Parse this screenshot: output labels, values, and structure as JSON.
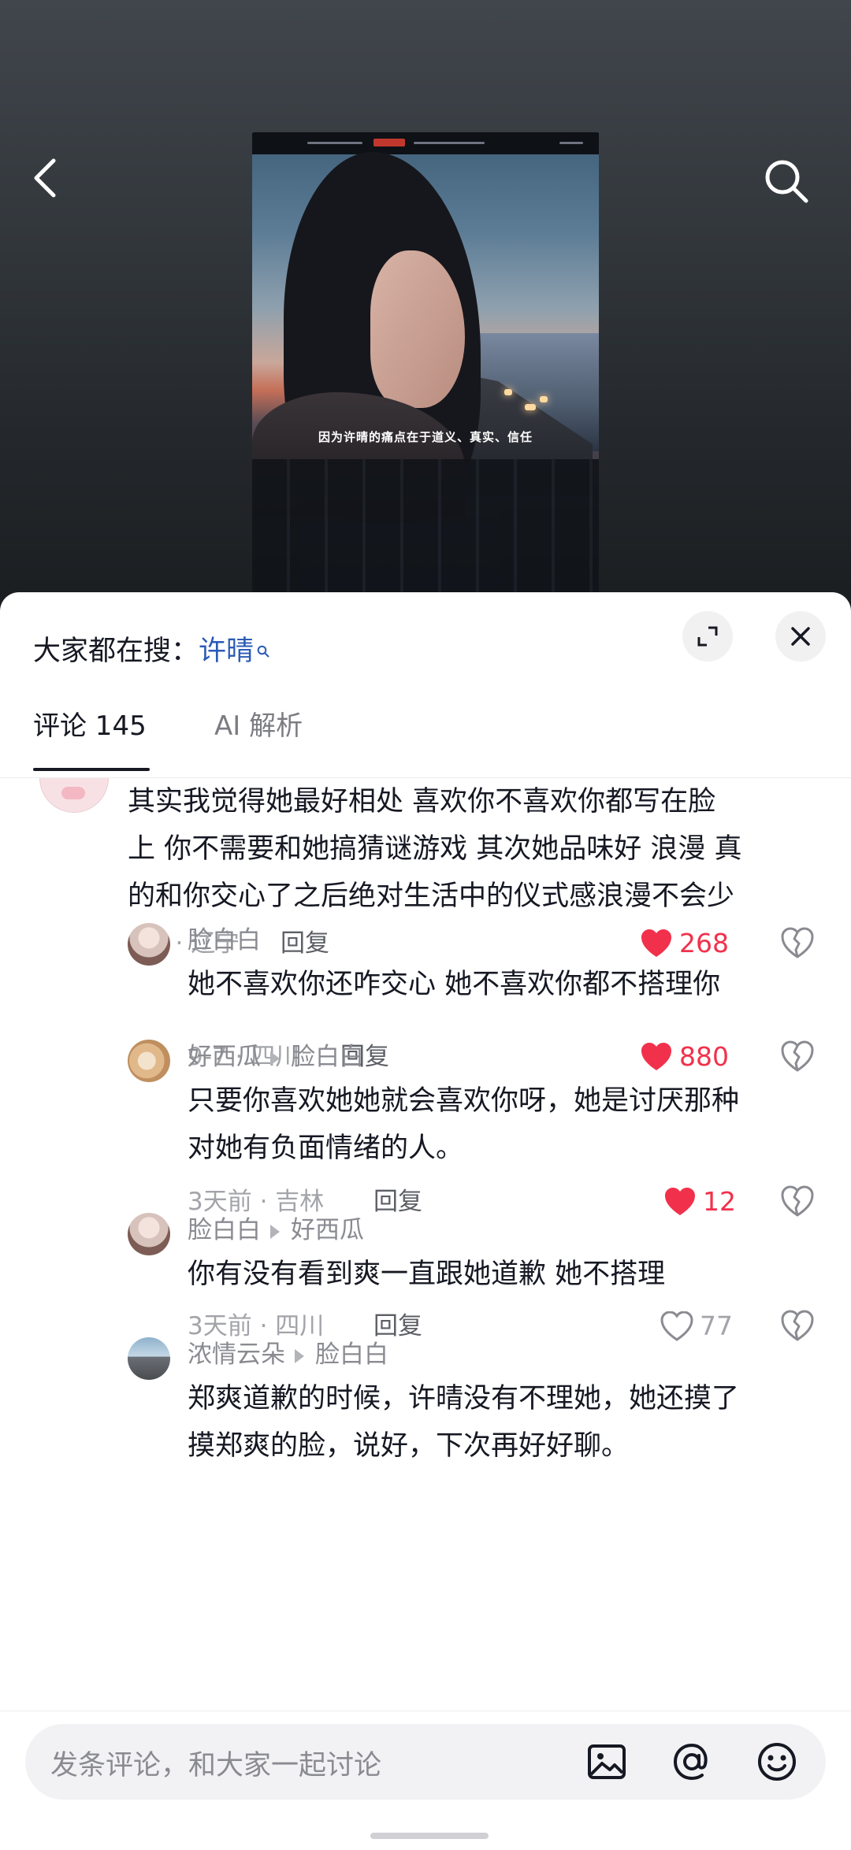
{
  "video": {
    "subtitle": "因为许晴的痛点在于道义、真实、信任"
  },
  "icons": {
    "back": "chevron-left-icon",
    "search": "search-icon",
    "expand": "expand-icon",
    "close": "close-icon",
    "heart": "heart-icon",
    "dislike": "broken-heart-icon",
    "image": "image-icon",
    "at": "at-icon",
    "emoji": "emoji-icon"
  },
  "colors": {
    "liked": "#f1314c",
    "keyword": "#2a5bb6",
    "text": "#161823",
    "meta": "#a3a4a9"
  },
  "hot_search": {
    "prefix": "大家都在搜：",
    "keyword": "许晴"
  },
  "tabs": {
    "comments": "评论 145",
    "ai": "AI 解析"
  },
  "comments": [
    {
      "text_lines": [
        "其实我觉得她最好相处 喜欢你不喜欢你都写在脸",
        "上 你不需要和她搞猜谜游戏 其次她品味好 浪漫 真",
        "的和你交心了之后绝对生活中的仪式感浪漫不会少"
      ],
      "meta": "9-7 · 辽宁",
      "reply": "回复",
      "likes": "268",
      "liked": true
    },
    {
      "user": "脸白白",
      "text_lines": [
        "她不喜欢你还咋交心 她不喜欢你都不搭理你"
      ],
      "meta": "9-7 · 四川",
      "reply": "回复",
      "likes": "880",
      "liked": true
    },
    {
      "user": "好西瓜",
      "reply_to": "脸白白",
      "text_lines": [
        "只要你喜欢她她就会喜欢你呀，她是讨厌那种",
        "对她有负面情绪的人。"
      ],
      "meta": "3天前 · 吉林",
      "reply": "回复",
      "likes": "12",
      "liked": true
    },
    {
      "user": "脸白白",
      "reply_to": "好西瓜",
      "text_lines": [
        "你有没有看到爽一直跟她道歉 她不搭理"
      ],
      "meta": "3天前 · 四川",
      "reply": "回复",
      "likes": "77",
      "liked": false
    },
    {
      "user": "浓情云朵",
      "reply_to": "脸白白",
      "text_lines": [
        "郑爽道歉的时候，许晴没有不理她，她还摸了",
        "摸郑爽的脸，说好，下次再好好聊。"
      ]
    }
  ],
  "input": {
    "placeholder": "发条评论，和大家一起讨论"
  }
}
